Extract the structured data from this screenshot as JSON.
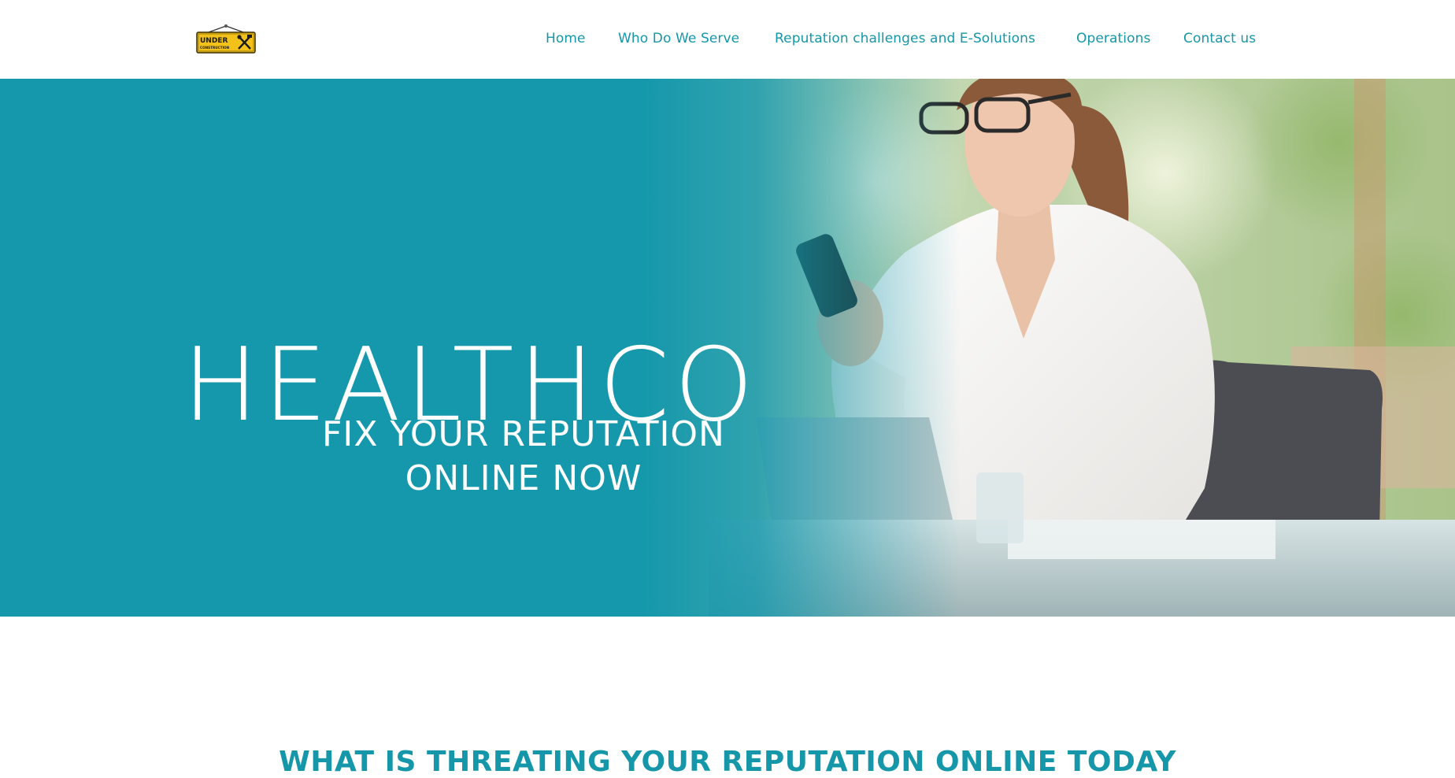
{
  "header": {
    "logo_text_top": "UNDER",
    "logo_text_bottom": "CONSTRUCTION",
    "nav": [
      {
        "label": "Home"
      },
      {
        "label": "Who Do We Serve"
      },
      {
        "label": "Reputation challenges and E-Solutions"
      },
      {
        "label": "Operations"
      },
      {
        "label": "Contact us"
      }
    ]
  },
  "hero": {
    "title": "HEALTHCO",
    "subtitle_line1": "FIX YOUR REPUTATION",
    "subtitle_line2": "ONLINE NOW"
  },
  "section": {
    "heading": "WHAT IS THREATING YOUR REPUTATION ONLINE TODAY"
  },
  "colors": {
    "accent": "#1597a9",
    "hero_overlay": "#1598ab",
    "logo_yellow": "#f2c21b"
  },
  "icons": {
    "logo": "under-construction-sign-icon"
  }
}
